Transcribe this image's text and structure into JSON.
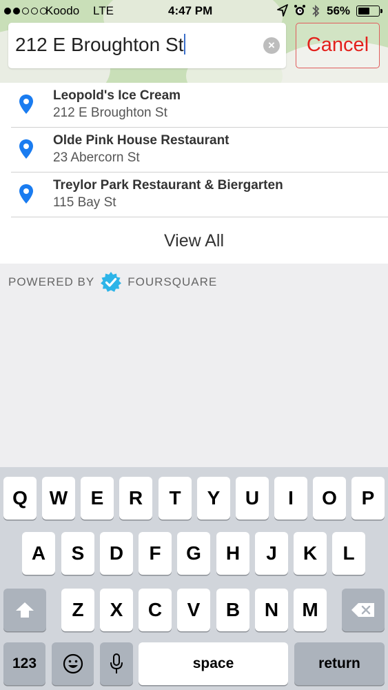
{
  "status_bar": {
    "carrier": "Koodo",
    "network": "LTE",
    "time": "4:47 PM",
    "battery_percent": "56%",
    "signal_bars_filled": 2,
    "signal_bars_total": 5,
    "icons": [
      "location-arrow-icon",
      "alarm-icon",
      "bluetooth-icon"
    ]
  },
  "search": {
    "value": "212 E Broughton St",
    "cancel_label": "Cancel"
  },
  "results": [
    {
      "name": "Leopold's Ice Cream",
      "address": "212 E Broughton St",
      "icon": "location-pin-icon"
    },
    {
      "name": "Olde Pink House Restaurant",
      "address": "23 Abercorn St",
      "icon": "location-pin-icon"
    },
    {
      "name": "Treylor Park Restaurant & Biergarten",
      "address": "115 Bay St",
      "icon": "location-pin-icon"
    }
  ],
  "view_all_label": "View All",
  "powered_by": {
    "prefix": "POWERED BY",
    "brand": "FOURSQUARE"
  },
  "keyboard": {
    "row1": [
      "Q",
      "W",
      "E",
      "R",
      "T",
      "Y",
      "U",
      "I",
      "O",
      "P"
    ],
    "row2": [
      "A",
      "S",
      "D",
      "F",
      "G",
      "H",
      "J",
      "K",
      "L"
    ],
    "row3": [
      "Z",
      "X",
      "C",
      "V",
      "B",
      "N",
      "M"
    ],
    "numbers_label": "123",
    "space_label": "space",
    "return_label": "return"
  },
  "colors": {
    "accent_red": "#e3211c",
    "pin_blue": "#1a7cf0",
    "foursquare_blue": "#2db4e8"
  }
}
